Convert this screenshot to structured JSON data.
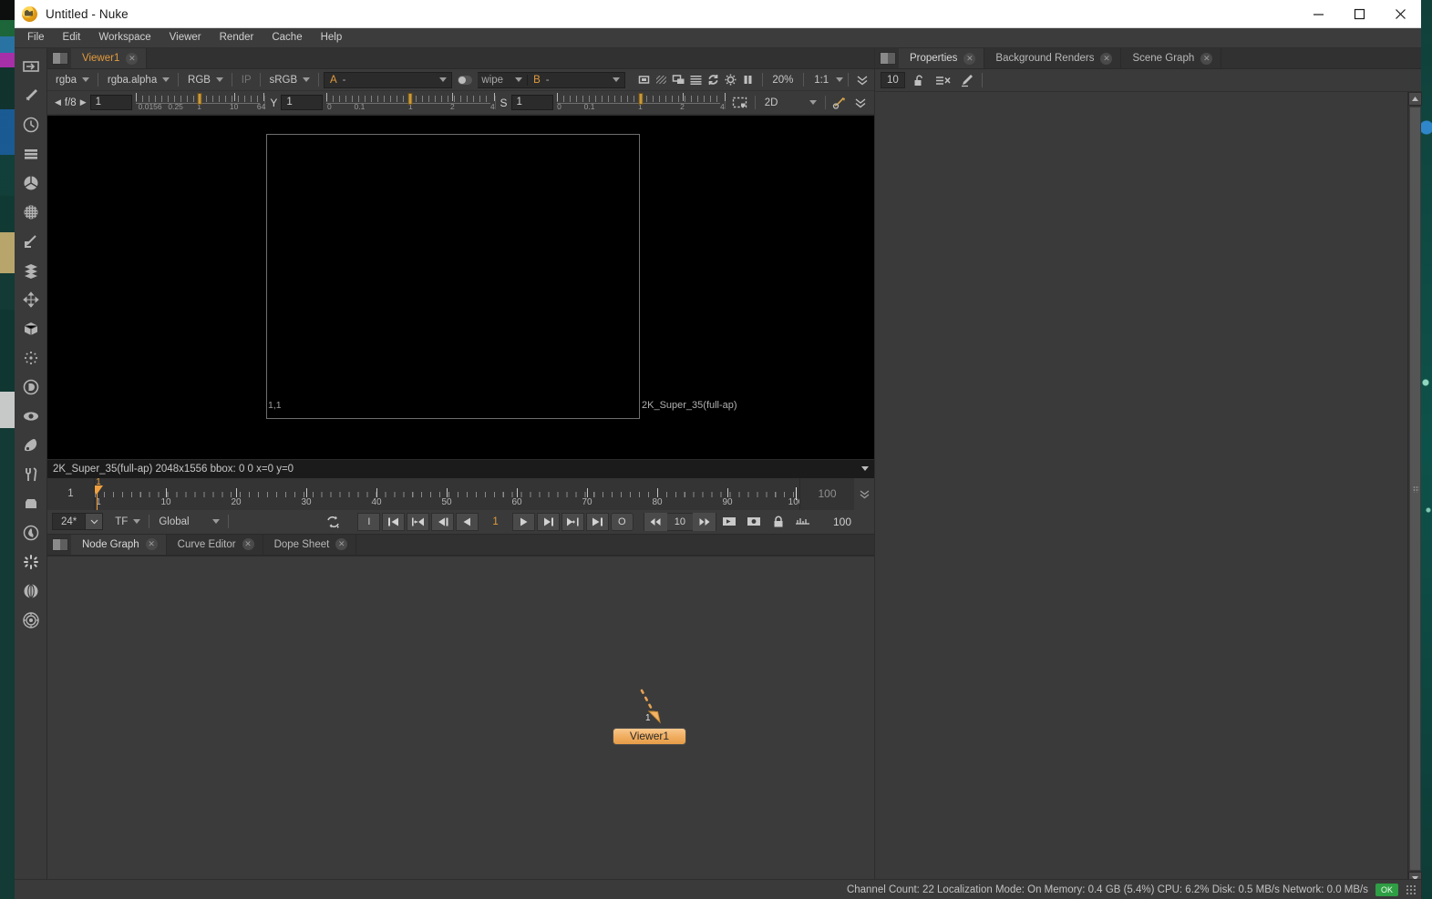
{
  "window": {
    "title": "Untitled - Nuke",
    "app_icon": "nuke-logo-icon",
    "minimize": "minimize-icon",
    "maximize": "maximize-icon",
    "close": "close-icon"
  },
  "menubar": {
    "items": [
      {
        "label": "File"
      },
      {
        "label": "Edit"
      },
      {
        "label": "Workspace"
      },
      {
        "label": "Viewer"
      },
      {
        "label": "Render"
      },
      {
        "label": "Cache"
      },
      {
        "label": "Help"
      }
    ]
  },
  "node_toolbar": {
    "items": [
      {
        "name": "image-node-icon",
        "tip": "Image"
      },
      {
        "name": "draw-node-icon",
        "tip": "Draw"
      },
      {
        "name": "time-node-icon",
        "tip": "Time"
      },
      {
        "name": "channel-node-icon",
        "tip": "Channel"
      },
      {
        "name": "color-node-icon",
        "tip": "Color"
      },
      {
        "name": "filter-node-icon",
        "tip": "Filter"
      },
      {
        "name": "keyer-node-icon",
        "tip": "Keyer"
      },
      {
        "name": "merge-node-icon",
        "tip": "Merge"
      },
      {
        "name": "transform-node-icon",
        "tip": "Transform"
      },
      {
        "name": "three-d-node-icon",
        "tip": "3D"
      },
      {
        "name": "particles-node-icon",
        "tip": "Particles"
      },
      {
        "name": "deep-node-icon",
        "tip": "Deep"
      },
      {
        "name": "views-node-icon",
        "tip": "Views"
      },
      {
        "name": "metadata-node-icon",
        "tip": "Metadata"
      },
      {
        "name": "toolsets-node-icon",
        "tip": "Toolsets"
      },
      {
        "name": "other-node-icon",
        "tip": "Other"
      },
      {
        "name": "furnace-node-icon",
        "tip": "Furnace"
      },
      {
        "name": "sparkles-node-icon",
        "tip": "Plugins"
      },
      {
        "name": "ocula-node-icon",
        "tip": "Ocula"
      },
      {
        "name": "cara-vr-node-icon",
        "tip": "CaraVR"
      }
    ]
  },
  "viewer_panel": {
    "tabs": [
      {
        "label": "Viewer1",
        "active": true,
        "closable": true
      }
    ],
    "controls_row1": {
      "channel_set": "rgba",
      "channel": "rgba.alpha",
      "display_channels": "RGB",
      "ip_label": "IP",
      "viewer_process": "sRGB",
      "input_a_key": "A",
      "input_a_value": "-",
      "blend_mode": "wipe",
      "input_b_key": "B",
      "input_b_value": "-",
      "icons": [
        "proxy-icon",
        "roi-icon",
        "overscan-icon",
        "interlace-icon",
        "refresh-icon",
        "pause-icon",
        "clipwarning-icon"
      ],
      "zoom": "20%",
      "scale": "1:1",
      "more": "chevron-double-down-icon"
    },
    "controls_row2": {
      "gain_label": "f/8",
      "gain_value": "1",
      "gain_ticks": [
        "0.0156",
        "0.25",
        "1",
        "10",
        "64"
      ],
      "gamma_label": "Y",
      "gamma_value": "1",
      "gamma_ticks": [
        "0",
        "0.1",
        "1",
        "2",
        "4"
      ],
      "sat_label": "S",
      "sat_value": "1",
      "sat_ticks": [
        "0",
        "0.1",
        "1",
        "2",
        "4"
      ],
      "roi_icon": "marquee-icon",
      "view_mode": "2D",
      "stereo_icon": "stereo-icon",
      "more": "chevron-double-down-icon"
    },
    "canvas": {
      "format_origin_label": "1,1",
      "format_name_label": "2K_Super_35(full-ap)"
    },
    "info_bar": {
      "text": "2K_Super_35(full-ap) 2048x1556  bbox: 0 0   x=0 y=0",
      "menu_icon": "chevron-down-icon"
    }
  },
  "timeline": {
    "start_frame": "1",
    "end_frame": "100",
    "playhead_frame": "1",
    "major_ticks": [
      "1",
      "10",
      "20",
      "30",
      "40",
      "50",
      "60",
      "70",
      "80",
      "90",
      "100"
    ],
    "expand_icon": "chevron-double-down-icon"
  },
  "playback": {
    "fps": "24*",
    "fps_caret": "chevron-down-icon",
    "timecode_mode": "TF",
    "lock_range": "Global",
    "loop_icon": "loop-mode-icon",
    "buttons": [
      {
        "name": "in-point-button",
        "glyph": "I"
      },
      {
        "name": "first-frame-button",
        "glyph": "first-frame-icon"
      },
      {
        "name": "previous-keyframe-button",
        "glyph": "prev-key-icon"
      },
      {
        "name": "play-backward-button",
        "glyph": "play-backward-icon"
      },
      {
        "name": "previous-frame-button",
        "glyph": "prev-frame-icon"
      }
    ],
    "current_frame": "1",
    "buttons_right": [
      {
        "name": "play-forward-button",
        "glyph": "play-forward-icon"
      },
      {
        "name": "next-frame-button",
        "glyph": "next-frame-icon"
      },
      {
        "name": "next-keyframe-button",
        "glyph": "next-key-icon"
      },
      {
        "name": "last-frame-button",
        "glyph": "last-frame-icon"
      },
      {
        "name": "out-point-button",
        "glyph": "O"
      }
    ],
    "increment_back": "step-back-icon",
    "increment_value": "10",
    "increment_forward": "step-forward-icon",
    "right_icons": [
      "playback-range-icon",
      "stop-icon",
      "lock-range-icon",
      "key-range-icon"
    ],
    "out_value": "100"
  },
  "graph_panel": {
    "tabs": [
      {
        "label": "Node Graph",
        "active": true,
        "closable": true
      },
      {
        "label": "Curve Editor",
        "active": false,
        "closable": true
      },
      {
        "label": "Dope Sheet",
        "active": false,
        "closable": true
      }
    ],
    "nodes": [
      {
        "name": "Viewer1",
        "input_label": "1"
      }
    ]
  },
  "properties_panel": {
    "tabs": [
      {
        "label": "Properties",
        "active": true,
        "closable": true
      },
      {
        "label": "Background Renders",
        "active": false,
        "closable": true
      },
      {
        "label": "Scene Graph",
        "active": false,
        "closable": true
      }
    ],
    "toolbar": {
      "max_panels": "10",
      "icons": [
        "unlock-icon",
        "close-all-icon",
        "edit-icon"
      ]
    }
  },
  "statusbar": {
    "text": "Channel Count: 22 Localization Mode: On Memory: 0.4 GB (5.4%) CPU: 6.2% Disk: 0.5 MB/s Network: 0.0 MB/s",
    "badge": "OK",
    "grip": "resize-grip-icon"
  },
  "colors": {
    "accent_orange": "#e39b3d",
    "node_orange": "#f0ac5e",
    "panel_bg": "#3a3a3a",
    "dark_bg": "#313131",
    "status_ok": "#2f9e44"
  }
}
